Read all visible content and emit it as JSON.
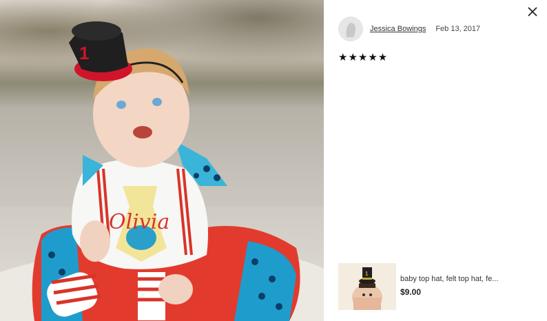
{
  "review": {
    "reviewer_name": "Jessica Bowings",
    "date": "Feb 13, 2017",
    "rating": 5,
    "stars_text": "★★★★★"
  },
  "photo": {
    "shirt_text": "Olivia",
    "hat_number": "1"
  },
  "product": {
    "title": "baby top hat, felt top hat, fe...",
    "price": "$9.00"
  },
  "icons": {
    "close": "close-icon",
    "avatar": "avatar-placeholder-icon"
  }
}
